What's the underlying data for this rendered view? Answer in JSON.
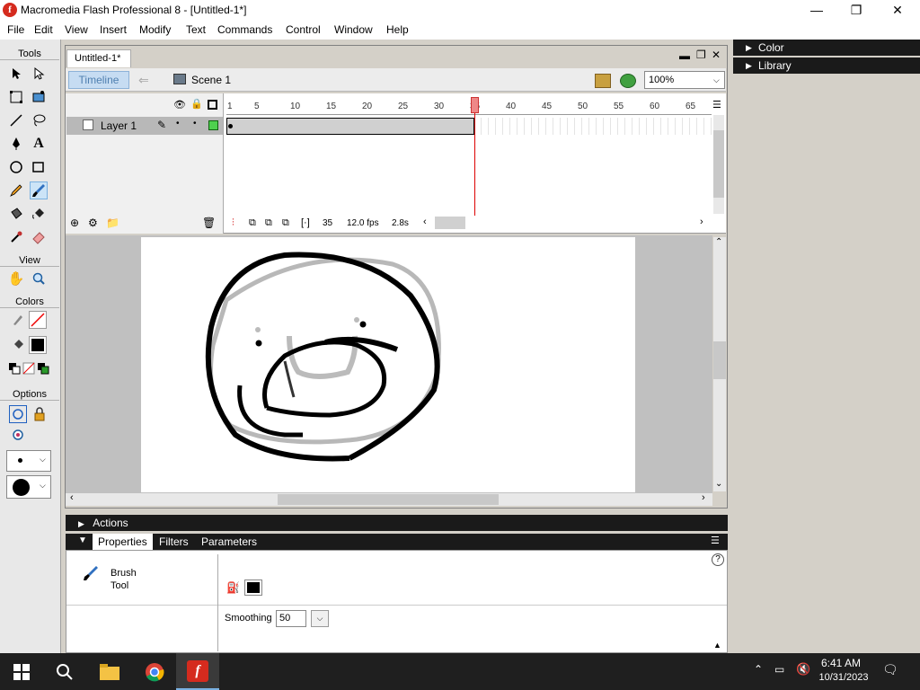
{
  "window": {
    "title": "Macromedia Flash Professional 8 - [Untitled-1*]",
    "app_icon_glyph": "f",
    "controls": [
      "—",
      "❐",
      "✕"
    ]
  },
  "menu": [
    "File",
    "Edit",
    "View",
    "Insert",
    "Modify",
    "Text",
    "Commands",
    "Control",
    "Window",
    "Help"
  ],
  "tools": {
    "header": "Tools",
    "view_header": "View",
    "colors_header": "Colors",
    "options_header": "Options",
    "selected": "brush-tool"
  },
  "document": {
    "tab": "Untitled-1*",
    "timeline_button": "Timeline",
    "scene": "Scene 1",
    "zoom": "100%"
  },
  "timeline": {
    "layer": "Layer 1",
    "frame_numbers": [
      "1",
      "5",
      "10",
      "15",
      "20",
      "25",
      "30",
      "35",
      "40",
      "45",
      "50",
      "55",
      "60",
      "65"
    ],
    "current_frame": "35",
    "fps": "12.0 fps",
    "time": "2.8s"
  },
  "panels": {
    "actions": "Actions",
    "tabs": [
      "Properties",
      "Filters",
      "Parameters"
    ],
    "tool_name_line1": "Brush",
    "tool_name_line2": "Tool",
    "smoothing_label": "Smoothing",
    "smoothing_value": "50",
    "help_glyph": "?"
  },
  "right_panels": [
    "Color",
    "Library"
  ],
  "taskbar": {
    "time": "6:41 AM",
    "date": "10/31/2023"
  },
  "colors": {
    "stroke": "#000000",
    "fill": "#000000",
    "playhead": "#e07070"
  }
}
